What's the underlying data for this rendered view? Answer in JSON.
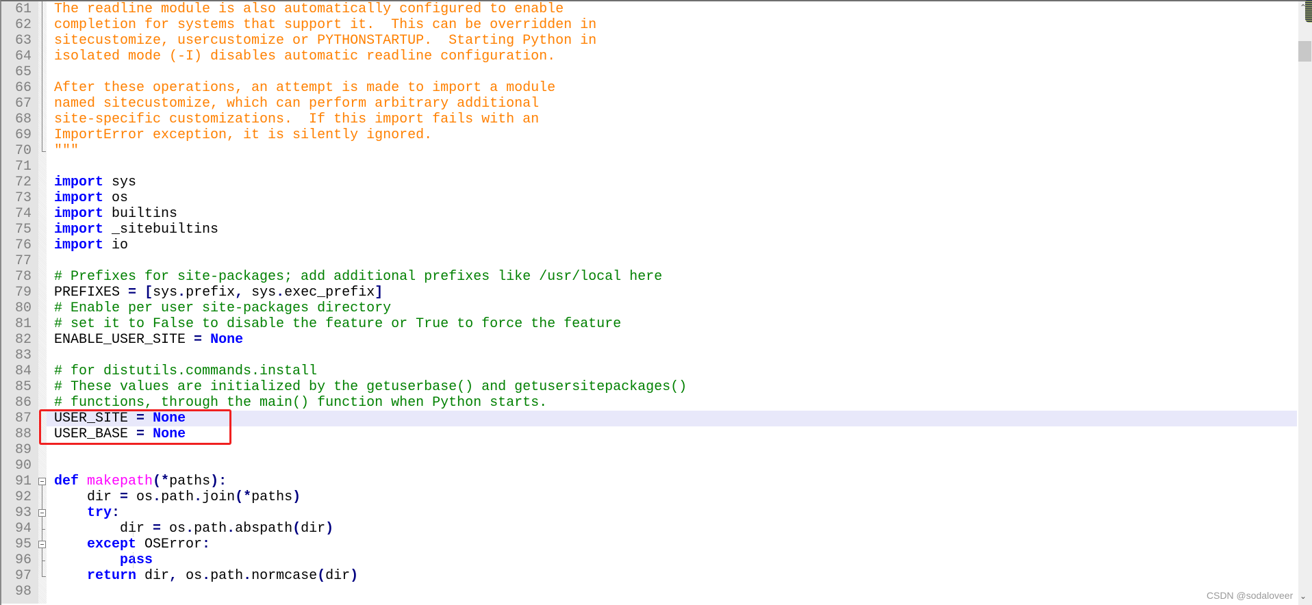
{
  "colors": {
    "docstring": "#FF8000",
    "comment": "#008000",
    "keyword": "#0000FF",
    "function": "#FF00FF",
    "operator": "#000080",
    "highlight": "#E8E8FA",
    "annotation_box": "#F02020"
  },
  "highlighted_line": 87,
  "lines": [
    {
      "n": "61",
      "fold": "v",
      "tokens": [
        [
          "doc",
          "The readline module is also automatically configured to enable"
        ]
      ]
    },
    {
      "n": "62",
      "fold": "v",
      "tokens": [
        [
          "doc",
          "completion for systems that support it.  This can be overridden in"
        ]
      ]
    },
    {
      "n": "63",
      "fold": "v",
      "tokens": [
        [
          "doc",
          "sitecustomize, usercustomize or PYTHONSTARTUP.  Starting Python in"
        ]
      ]
    },
    {
      "n": "64",
      "fold": "v",
      "tokens": [
        [
          "doc",
          "isolated mode (-I) disables automatic readline configuration."
        ]
      ]
    },
    {
      "n": "65",
      "fold": "v",
      "tokens": []
    },
    {
      "n": "66",
      "fold": "v",
      "tokens": [
        [
          "doc",
          "After these operations, an attempt is made to import a module"
        ]
      ]
    },
    {
      "n": "67",
      "fold": "v",
      "tokens": [
        [
          "doc",
          "named sitecustomize, which can perform arbitrary additional"
        ]
      ]
    },
    {
      "n": "68",
      "fold": "v",
      "tokens": [
        [
          "doc",
          "site-specific customizations.  If this import fails with an"
        ]
      ]
    },
    {
      "n": "69",
      "fold": "v",
      "tokens": [
        [
          "doc",
          "ImportError exception, it is silently ignored."
        ]
      ]
    },
    {
      "n": "70",
      "fold": "corner",
      "tokens": [
        [
          "doc",
          "\"\"\""
        ]
      ]
    },
    {
      "n": "71",
      "tokens": []
    },
    {
      "n": "72",
      "tokens": [
        [
          "kw",
          "import"
        ],
        [
          "id",
          " sys"
        ]
      ]
    },
    {
      "n": "73",
      "tokens": [
        [
          "kw",
          "import"
        ],
        [
          "id",
          " os"
        ]
      ]
    },
    {
      "n": "74",
      "tokens": [
        [
          "kw",
          "import"
        ],
        [
          "id",
          " builtins"
        ]
      ]
    },
    {
      "n": "75",
      "tokens": [
        [
          "kw",
          "import"
        ],
        [
          "id",
          " _sitebuiltins"
        ]
      ]
    },
    {
      "n": "76",
      "tokens": [
        [
          "kw",
          "import"
        ],
        [
          "id",
          " io"
        ]
      ]
    },
    {
      "n": "77",
      "tokens": []
    },
    {
      "n": "78",
      "tokens": [
        [
          "cmt",
          "# Prefixes for site-packages; add additional prefixes like /usr/local here"
        ]
      ]
    },
    {
      "n": "79",
      "tokens": [
        [
          "id",
          "PREFIXES "
        ],
        [
          "op",
          "="
        ],
        [
          "id",
          " "
        ],
        [
          "op",
          "["
        ],
        [
          "id",
          "sys"
        ],
        [
          "op",
          "."
        ],
        [
          "id",
          "prefix"
        ],
        [
          "op",
          ","
        ],
        [
          "id",
          " sys"
        ],
        [
          "op",
          "."
        ],
        [
          "id",
          "exec_prefix"
        ],
        [
          "op",
          "]"
        ]
      ]
    },
    {
      "n": "80",
      "tokens": [
        [
          "cmt",
          "# Enable per user site-packages directory"
        ]
      ]
    },
    {
      "n": "81",
      "tokens": [
        [
          "cmt",
          "# set it to False to disable the feature or True to force the feature"
        ]
      ]
    },
    {
      "n": "82",
      "tokens": [
        [
          "id",
          "ENABLE_USER_SITE "
        ],
        [
          "op",
          "="
        ],
        [
          "id",
          " "
        ],
        [
          "kw",
          "None"
        ]
      ]
    },
    {
      "n": "83",
      "tokens": []
    },
    {
      "n": "84",
      "tokens": [
        [
          "cmt",
          "# for distutils.commands.install"
        ]
      ]
    },
    {
      "n": "85",
      "tokens": [
        [
          "cmt",
          "# These values are initialized by the getuserbase() and getusersitepackages()"
        ]
      ]
    },
    {
      "n": "86",
      "tokens": [
        [
          "cmt",
          "# functions, through the main() function when Python starts."
        ]
      ]
    },
    {
      "n": "87",
      "tokens": [
        [
          "id",
          "USER_SITE "
        ],
        [
          "op",
          "="
        ],
        [
          "id",
          " "
        ],
        [
          "kw",
          "None"
        ]
      ]
    },
    {
      "n": "88",
      "tokens": [
        [
          "id",
          "USER_BASE "
        ],
        [
          "op",
          "="
        ],
        [
          "id",
          " "
        ],
        [
          "kw",
          "None"
        ]
      ]
    },
    {
      "n": "89",
      "tokens": []
    },
    {
      "n": "90",
      "tokens": []
    },
    {
      "n": "91",
      "fold": "box",
      "tokens": [
        [
          "kw",
          "def"
        ],
        [
          "id",
          " "
        ],
        [
          "fn",
          "makepath"
        ],
        [
          "op",
          "(*"
        ],
        [
          "id",
          "paths"
        ],
        [
          "op",
          "):"
        ]
      ]
    },
    {
      "n": "92",
      "fold": "v",
      "tokens": [
        [
          "id",
          "    dir "
        ],
        [
          "op",
          "="
        ],
        [
          "id",
          " os"
        ],
        [
          "op",
          "."
        ],
        [
          "id",
          "path"
        ],
        [
          "op",
          "."
        ],
        [
          "id",
          "join"
        ],
        [
          "op",
          "(*"
        ],
        [
          "id",
          "paths"
        ],
        [
          "op",
          ")"
        ]
      ]
    },
    {
      "n": "93",
      "fold": "boxv",
      "tokens": [
        [
          "id",
          "    "
        ],
        [
          "kw",
          "try"
        ],
        [
          "op",
          ":"
        ]
      ]
    },
    {
      "n": "94",
      "fold": "tick",
      "guide": true,
      "tokens": [
        [
          "id",
          "        dir "
        ],
        [
          "op",
          "="
        ],
        [
          "id",
          " os"
        ],
        [
          "op",
          "."
        ],
        [
          "id",
          "path"
        ],
        [
          "op",
          "."
        ],
        [
          "id",
          "abspath"
        ],
        [
          "op",
          "("
        ],
        [
          "id",
          "dir"
        ],
        [
          "op",
          ")"
        ]
      ]
    },
    {
      "n": "95",
      "fold": "boxv",
      "tokens": [
        [
          "id",
          "    "
        ],
        [
          "kw",
          "except"
        ],
        [
          "id",
          " OSError"
        ],
        [
          "op",
          ":"
        ]
      ]
    },
    {
      "n": "96",
      "fold": "tick",
      "guide": true,
      "tokens": [
        [
          "id",
          "        "
        ],
        [
          "kw",
          "pass"
        ]
      ]
    },
    {
      "n": "97",
      "fold": "corner",
      "tokens": [
        [
          "id",
          "    "
        ],
        [
          "kw",
          "return"
        ],
        [
          "id",
          " dir"
        ],
        [
          "op",
          ","
        ],
        [
          "id",
          " os"
        ],
        [
          "op",
          "."
        ],
        [
          "id",
          "path"
        ],
        [
          "op",
          "."
        ],
        [
          "id",
          "normcase"
        ],
        [
          "op",
          "("
        ],
        [
          "id",
          "dir"
        ],
        [
          "op",
          ")"
        ]
      ]
    },
    {
      "n": "98",
      "tokens": []
    }
  ],
  "watermark": "CSDN @sodaloveer"
}
